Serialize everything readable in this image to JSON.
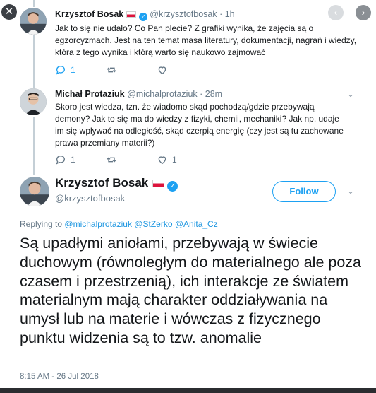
{
  "controls": {
    "close": "✕",
    "prev": "‹",
    "next": "›",
    "caret": "⌄"
  },
  "tweets": [
    {
      "name": "Krzysztof Bosak",
      "handle": "@krzysztofbosak",
      "time": "· 1h",
      "text": "Jak to się nie udało? Co Pan plecie? Z grafiki wynika, że zajęcia są o egzorcyzmach. Jest na ten temat masa literatury, dokumentacji, nagrań i wiedzy, która z tego wynika i którą warto się naukowo zajmować",
      "reply_count": "1",
      "retweet_count": "",
      "like_count": ""
    },
    {
      "name": "Michał Protaziuk",
      "handle": "@michalprotaziuk",
      "time": "· 28m",
      "text": "Skoro jest wiedza, tzn. że wiadomo skąd pochodzą/gdzie przebywają demony? Jak to się ma do wiedzy z fizyki, chemii, mechaniki? Jak np. udaje im się wpływać na odległość, skąd czerpią energię (czy jest są tu zachowane prawa przemiany materii?)",
      "reply_count": "1",
      "retweet_count": "",
      "like_count": "1"
    }
  ],
  "main": {
    "name": "Krzysztof Bosak",
    "handle": "@krzysztofbosak",
    "follow_label": "Follow",
    "replying_prefix": "Replying to",
    "mentions": [
      "@michalprotaziuk",
      "@StZerko",
      "@Anita_Cz"
    ],
    "text": "Są upadłymi aniołami, przebywają w świecie duchowym (równoległym do materialnego ale poza czasem i przestrzenią), ich interakcje ze światem materialnym mają charakter oddziaływania na umysł lub na materie i wówczas z fizycznego punktu widzenia są to tzw. anomalie",
    "timestamp": "8:15 AM - 26 Jul 2018"
  },
  "colors": {
    "accent": "#1da1f2",
    "link": "#1b95e0",
    "muted": "#657786",
    "thread": "#c4cfd6"
  }
}
